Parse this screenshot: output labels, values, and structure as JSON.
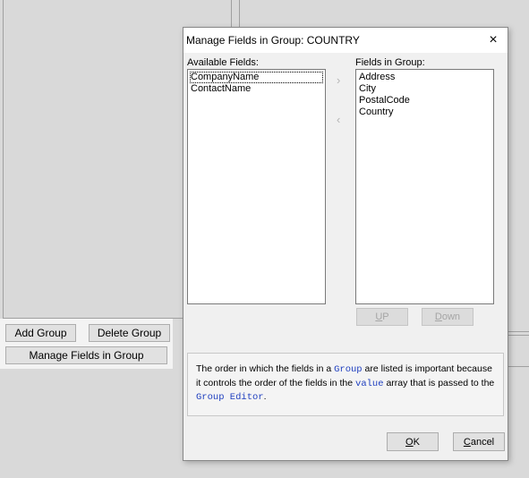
{
  "background": {
    "buttons": {
      "add_group": "Add Group",
      "delete_group": "Delete Group",
      "manage_fields": "Manage Fields in Group"
    }
  },
  "dialog": {
    "title": "Manage Fields in Group: COUNTRY",
    "close_icon": "×",
    "available_label": "Available Fields:",
    "in_group_label": "Fields in Group:",
    "available_fields": [
      "CompanyName",
      "ContactName"
    ],
    "group_fields": [
      "Address",
      "City",
      "PostalCode",
      "Country"
    ],
    "move_right_glyph": "›",
    "move_left_glyph": "‹",
    "up_label": {
      "accel": "U",
      "rest": "P"
    },
    "down_label": {
      "accel": "D",
      "rest": "own"
    },
    "info": {
      "t1": "The order in which the fields in a ",
      "c1": "Group",
      "t2": " are listed is important because it controls the order of the fields in the ",
      "c2": "value",
      "t3": " array that is passed to the ",
      "c3": "Group Editor",
      "t4": "."
    },
    "ok_label": {
      "accel": "O",
      "rest": "K"
    },
    "cancel_label": {
      "accel": "C",
      "rest": "ancel"
    }
  }
}
